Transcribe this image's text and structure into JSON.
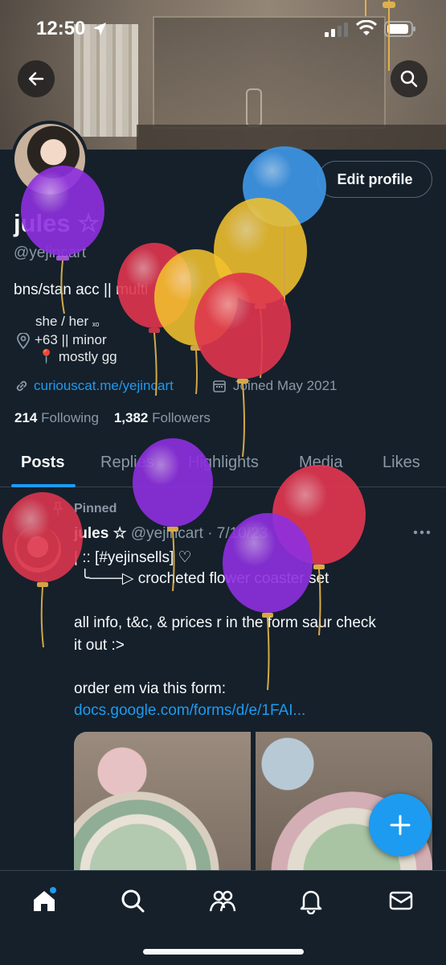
{
  "status_bar": {
    "time": "12:50"
  },
  "profile": {
    "display_name": "jules ☆",
    "handle": "@yejincart",
    "edit_button": "Edit profile",
    "bio": {
      "line1": "bns/stan acc || multi",
      "line2_text": "she / her ",
      "line2_suffix": "ₓₒ",
      "line3": "+63 || minor",
      "line4": "📍 mostly gg"
    },
    "link": "curiouscat.me/yejincart",
    "joined": "Joined May 2021",
    "following_count": "214",
    "following_label": "Following",
    "followers_count": "1,382",
    "followers_label": "Followers"
  },
  "tabs": [
    "Posts",
    "Replies",
    "Highlights",
    "Media",
    "Likes"
  ],
  "post": {
    "pinned_label": "Pinned",
    "author_name": "jules ☆",
    "author_handle": "@yejincart · 7/10/23",
    "line1": "| :: [#yejinsells] ♡",
    "line2": "╰───▷ crocheted flower coaster set",
    "line3": "all info, t&c, & prices r in the form saur check",
    "line4": "it out :>",
    "line5": "order em via this form:",
    "link": "docs.google.com/forms/d/e/1FAI..."
  },
  "colors": {
    "background": "#15202b",
    "accent": "#1d9bf0",
    "secondary_text": "#8b98a5",
    "balloon_purple": "#8e2fe0",
    "balloon_red": "#e0364f",
    "balloon_yellow": "#f2c12e",
    "balloon_blue": "#3f96e6"
  },
  "icons": {
    "back": "arrow-left-icon",
    "search": "search-icon",
    "compose": "plus-icon",
    "nav": [
      "home-icon",
      "search-icon",
      "communities-icon",
      "bell-icon",
      "mail-icon"
    ]
  }
}
